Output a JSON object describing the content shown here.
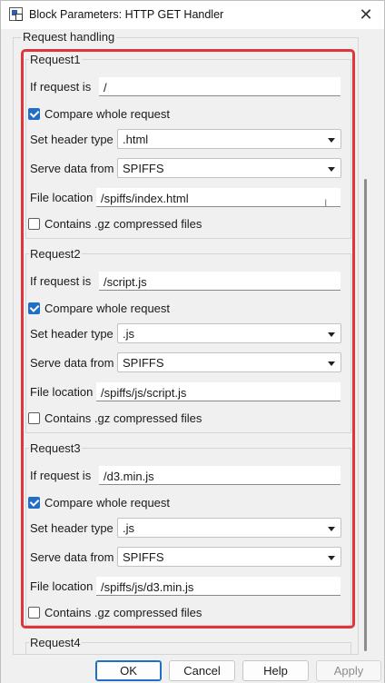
{
  "window": {
    "title": "Block Parameters: HTTP GET Handler",
    "close_glyph": "✕"
  },
  "section_label": "Request handling",
  "labels": {
    "if_request_is": "If request is",
    "compare_whole_request": "Compare whole request",
    "set_header_type": "Set header type",
    "serve_data_from": "Serve data from",
    "file_location": "File location",
    "contains_gz": "Contains .gz compressed files"
  },
  "requests": [
    {
      "title": "Request1",
      "if_request_is": "/",
      "compare_whole_request": true,
      "header_type": ".html",
      "serve_data_from": "SPIFFS",
      "file_location": "/spiffs/index.html",
      "contains_gz": false
    },
    {
      "title": "Request2",
      "if_request_is": "/script.js",
      "compare_whole_request": true,
      "header_type": ".js",
      "serve_data_from": "SPIFFS",
      "file_location": "/spiffs/js/script.js",
      "contains_gz": false
    },
    {
      "title": "Request3",
      "if_request_is": "/d3.min.js",
      "compare_whole_request": true,
      "header_type": ".js",
      "serve_data_from": "SPIFFS",
      "file_location": "/spiffs/js/d3.min.js",
      "contains_gz": false
    },
    {
      "title": "Request4"
    }
  ],
  "buttons": {
    "ok": "OK",
    "cancel": "Cancel",
    "help": "Help",
    "apply": "Apply"
  },
  "colors": {
    "highlight": "#e0353b",
    "checkbox_accent": "#1f6fc6"
  }
}
